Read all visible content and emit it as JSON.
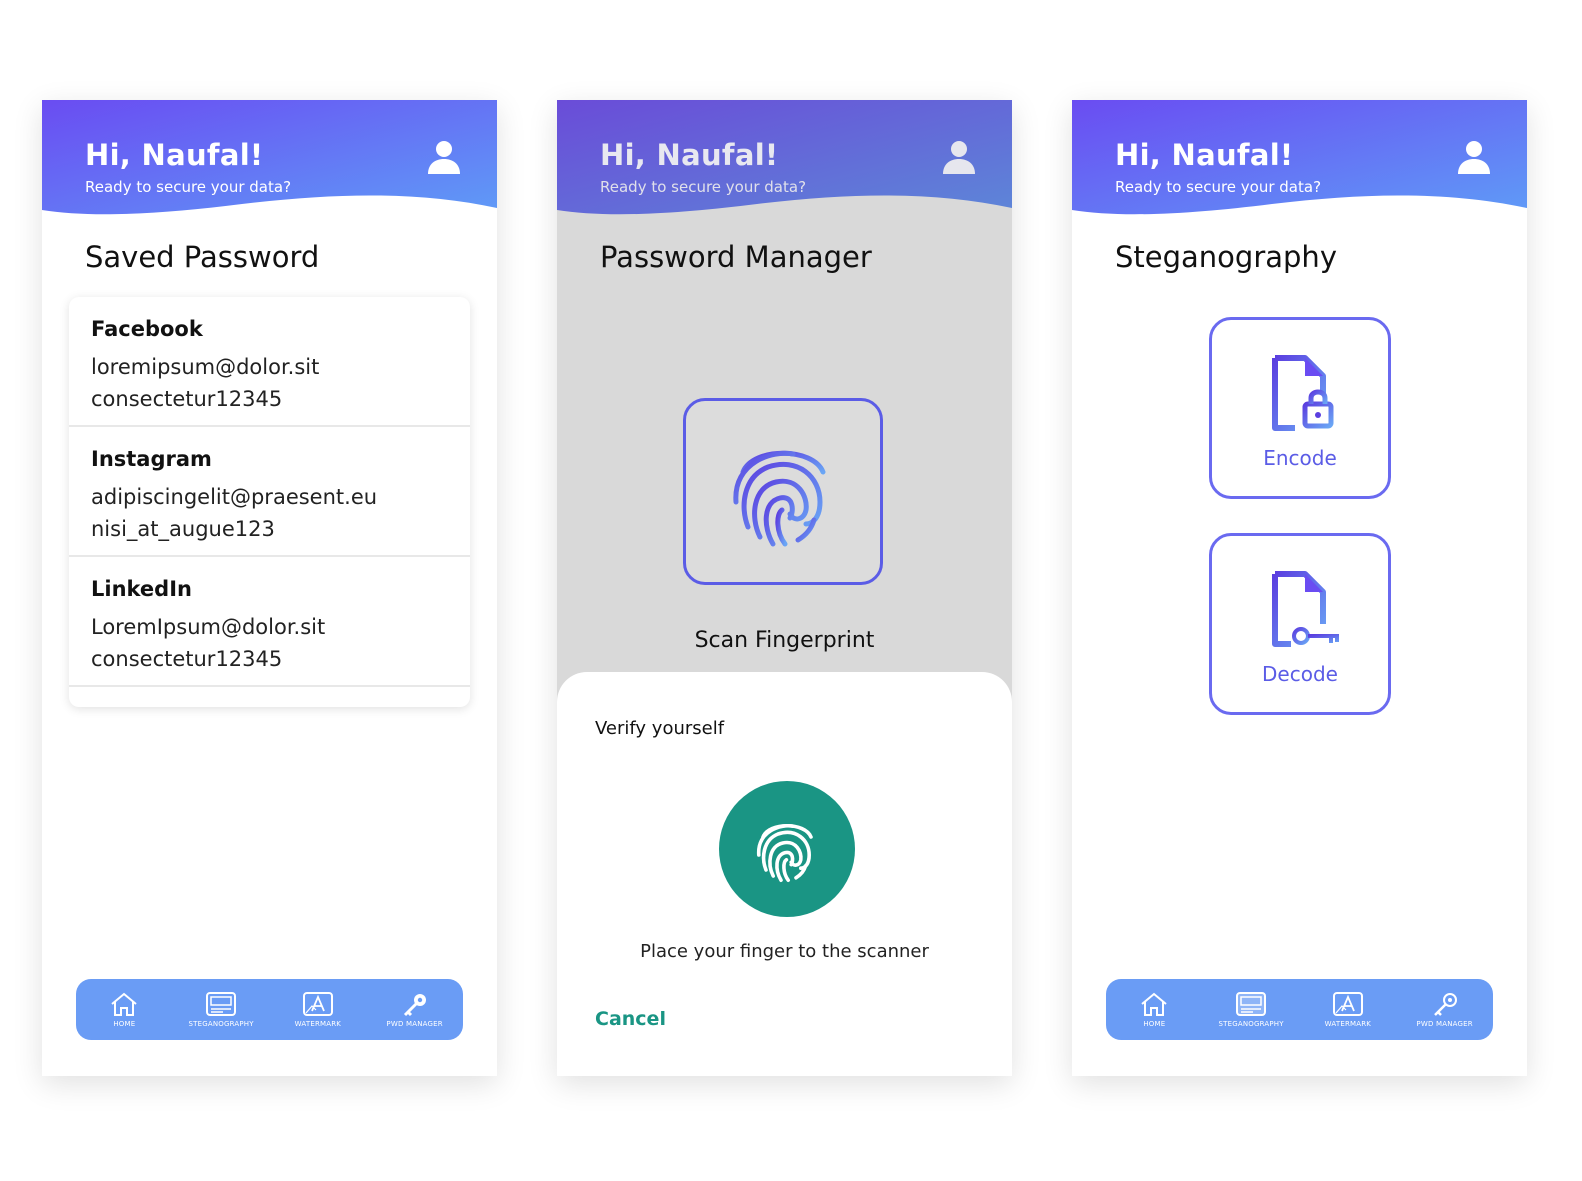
{
  "header": {
    "greeting": "Hi, Naufal!",
    "subtitle": "Ready to secure your data?"
  },
  "screen1": {
    "title": "Saved Password",
    "entries": [
      {
        "name": "Facebook",
        "email": "loremipsum@dolor.sit",
        "password": "consectetur12345"
      },
      {
        "name": "Instagram",
        "email": "adipiscingelit@praesent.eu",
        "password": "nisi_at_augue123"
      },
      {
        "name": "LinkedIn",
        "email": "LoremIpsum@dolor.sit",
        "password": "consectetur12345"
      }
    ]
  },
  "screen2": {
    "title": "Password Manager",
    "scan_label": "Scan Fingerprint",
    "sheet_title": "Verify yourself",
    "sheet_message": "Place your finger to the scanner",
    "cancel_label": "Cancel"
  },
  "screen3": {
    "title": "Steganography",
    "encode_label": "Encode",
    "decode_label": "Decode"
  },
  "nav": {
    "home": "HOME",
    "steganography": "STEGANOGRAPHY",
    "watermark": "WATERMARK",
    "pwd_manager": "PWD MANAGER"
  },
  "colors": {
    "gradient_start": "#6a4cf2",
    "gradient_end": "#5f9bf7",
    "nav_bg": "#6a9cf5",
    "accent_teal": "#1a9584",
    "accent_purple": "#5b5ce6"
  },
  "icons": {
    "profile": "user-icon",
    "fingerprint": "fingerprint-icon",
    "encode": "file-lock-icon",
    "decode": "file-key-icon",
    "nav": [
      "home-icon",
      "image-card-icon",
      "watermark-icon",
      "key-gear-icon"
    ]
  }
}
